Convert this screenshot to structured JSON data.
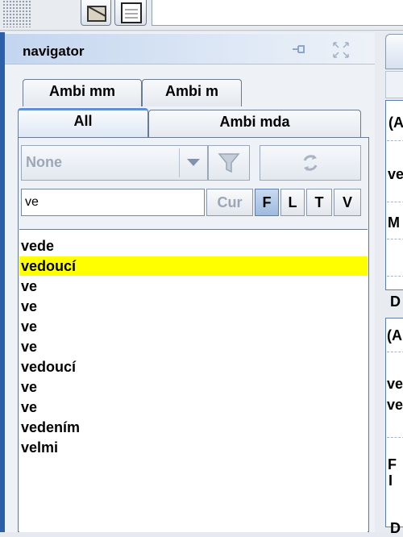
{
  "navigator": {
    "title": "navigator",
    "tabs_back": [
      "Ambi mm",
      "Ambi m"
    ],
    "tabs_front": [
      {
        "label": "All",
        "selected": true
      },
      {
        "label": "Ambi mda",
        "selected": false
      }
    ],
    "filter_select": {
      "value": "None"
    },
    "search": {
      "value": "ve"
    },
    "toggle_buttons": [
      {
        "label": "Cur",
        "enabled": false
      },
      {
        "label": "F",
        "active": true
      },
      {
        "label": "L",
        "active": false
      },
      {
        "label": "T",
        "active": false
      },
      {
        "label": "V",
        "active": false
      }
    ],
    "results": [
      {
        "text": "vede",
        "selected": false
      },
      {
        "text": "vedoucí",
        "selected": true
      },
      {
        "text": "ve",
        "selected": false
      },
      {
        "text": "ve",
        "selected": false
      },
      {
        "text": "ve",
        "selected": false
      },
      {
        "text": "ve",
        "selected": false
      },
      {
        "text": "vedoucí",
        "selected": false
      },
      {
        "text": "ve",
        "selected": false
      },
      {
        "text": "ve",
        "selected": false
      },
      {
        "text": "vedením",
        "selected": false
      },
      {
        "text": "velmi",
        "selected": false
      }
    ]
  },
  "right_panel": {
    "box1": [
      "(A",
      "ve",
      "M"
    ],
    "section_label": "D",
    "box2": [
      "(A",
      "ve",
      "ve",
      "F",
      "I"
    ],
    "bottom_label": "D"
  },
  "colors": {
    "selection": "#ffff00",
    "accent": "#2d5fa8",
    "active_toggle": "#9fbbe0"
  },
  "icons": [
    "pin-icon",
    "maximize-icon",
    "dropdown-arrow-icon",
    "filter-icon",
    "refresh-icon"
  ]
}
